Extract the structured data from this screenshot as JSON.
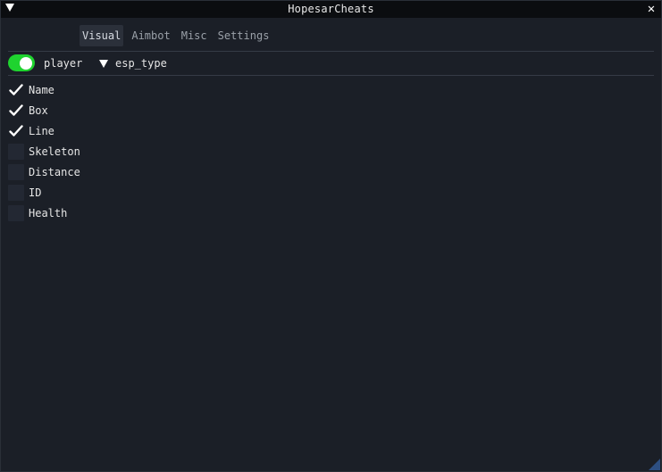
{
  "window": {
    "title": "HopesarCheats",
    "close_glyph": "✕"
  },
  "tabs": [
    {
      "label": "Visual",
      "active": true
    },
    {
      "label": "Aimbot",
      "active": false
    },
    {
      "label": "Misc",
      "active": false
    },
    {
      "label": "Settings",
      "active": false
    }
  ],
  "esp": {
    "enabled": true,
    "player_label": "player",
    "combo_label": "esp_type"
  },
  "options": [
    {
      "label": "Name",
      "checked": true
    },
    {
      "label": "Box",
      "checked": true
    },
    {
      "label": "Line",
      "checked": true
    },
    {
      "label": "Skeleton",
      "checked": false
    },
    {
      "label": "Distance",
      "checked": false
    },
    {
      "label": "ID",
      "checked": false
    },
    {
      "label": "Health",
      "checked": false
    }
  ],
  "colors": {
    "accent_green": "#1fd32f",
    "window_bg": "#1b1f27",
    "titlebar_bg": "#0b0d10",
    "resize_grip": "#2d4f82"
  },
  "icons": {
    "collapse": "collapse-arrow-icon",
    "close": "close-icon",
    "combo": "dropdown-arrow-icon",
    "check": "checkmark-icon"
  }
}
